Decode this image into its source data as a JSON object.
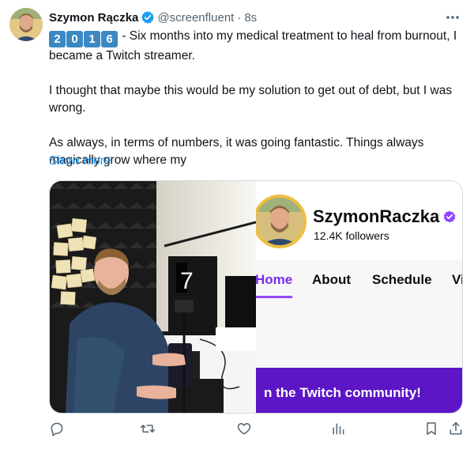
{
  "tweet": {
    "display_name": "Szymon Rączka",
    "handle": "@screenfluent",
    "separator": "·",
    "time": "8s",
    "keycaps": [
      "2",
      "0",
      "1",
      "6"
    ],
    "paragraph1": " - Six months into my medical treatment to heal from burnout, I became a Twitch streamer.",
    "paragraph2": "I thought that maybe this would be my solution to get out of debt, but I was wrong.",
    "paragraph3": "As always, in terms of numbers, it was going fantastic. Things always magically grow where my",
    "show_more": "Show more"
  },
  "media": {
    "channel_name": "SzymonRaczka",
    "followers": "12.4K followers",
    "tabs": [
      "Home",
      "About",
      "Schedule",
      "Vi"
    ],
    "active_tab": "Home",
    "banner_text": "n the Twitch community!",
    "monitor_digit": "7"
  },
  "colors": {
    "verified_blue": "#1d9bf0",
    "twitch_purple": "#9147ff",
    "banner_purple": "#5c16c5",
    "keycap_blue": "#3b88c3",
    "link_blue": "#1d9bf0"
  },
  "actions": [
    "reply-icon",
    "retweet-icon",
    "like-icon",
    "views-icon",
    "bookmark-icon",
    "share-icon"
  ]
}
